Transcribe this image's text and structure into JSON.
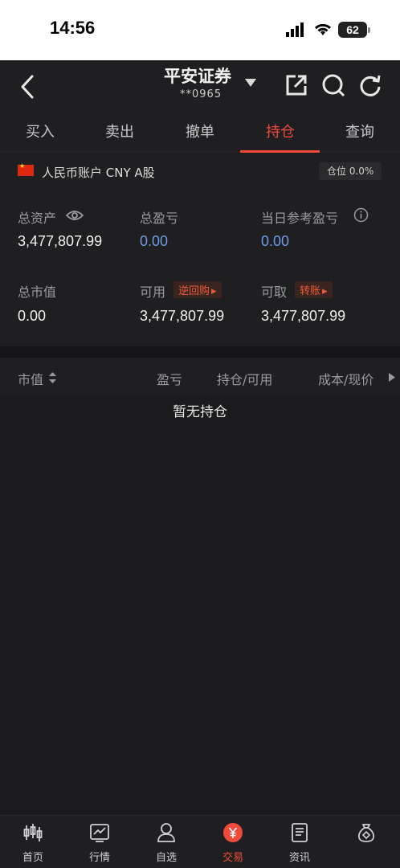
{
  "status_bar": {
    "time": "14:56",
    "battery": "62"
  },
  "header": {
    "title": "平安证券",
    "account": "**0965"
  },
  "tabs": [
    {
      "label": "买入"
    },
    {
      "label": "卖出"
    },
    {
      "label": "撤单"
    },
    {
      "label": "持仓",
      "active": true
    },
    {
      "label": "查询"
    }
  ],
  "account": {
    "name": "人民币账户 CNY A股",
    "position_badge": "仓位 0.0%"
  },
  "summary": {
    "total_assets_label": "总资产",
    "total_assets": "3,477,807.99",
    "total_pnl_label": "总盈亏",
    "total_pnl": "0.00",
    "daily_pnl_label": "当日参考盈亏",
    "daily_pnl": "0.00",
    "market_value_label": "总市值",
    "market_value": "0.00",
    "available_label": "可用",
    "available": "3,477,807.99",
    "repo_tag": "逆回购",
    "withdrawable_label": "可取",
    "withdrawable": "3,477,807.99",
    "transfer_tag": "转账"
  },
  "table": {
    "headers": [
      "市值",
      "盈亏",
      "持仓/可用",
      "成本/现价"
    ],
    "empty_text": "暂无持仓"
  },
  "nav": [
    {
      "label": "首页",
      "icon": "candlestick-icon"
    },
    {
      "label": "行情",
      "icon": "chart-icon"
    },
    {
      "label": "自选",
      "icon": "user-icon"
    },
    {
      "label": "交易",
      "icon": "yuan-icon",
      "active": true
    },
    {
      "label": "资讯",
      "icon": "document-icon"
    },
    {
      "label": "",
      "icon": "money-bag-icon"
    }
  ],
  "colors": {
    "accent": "#ef4b3b",
    "blue_value": "#6f9ce8",
    "background": "#1b1b1d"
  }
}
